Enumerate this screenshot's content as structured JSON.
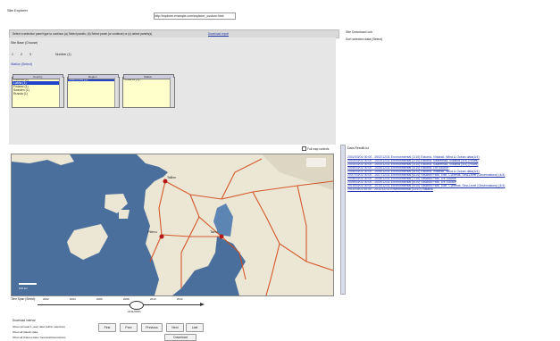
{
  "window": {
    "title": "Site Explorer",
    "url_label": "http://explorer.example.com/explorer_custom.html"
  },
  "header_bar": {
    "text": "Select a selection panel type to continue (a) Select panels; (b) Select panel (or continue) or (c) select panels(s)",
    "link": "Download report"
  },
  "search_panel": {
    "title": "Site Base (Choose)",
    "steps": [
      "1",
      "2",
      "3"
    ],
    "step_label": "Number (1)",
    "section_label": "Station (Select)",
    "lists": [
      {
        "header": "Country",
        "items": [
          "Estonia (1)",
          "Latvia (1)",
          "Finland (1)",
          "Sweden (1)",
          "Russia (1)"
        ],
        "selected": 1
      },
      {
        "header": "Region",
        "items": [
          "Saaremaa (1)"
        ],
        "selected": 0
      },
      {
        "header": "Station",
        "items": [
          "Vilsandi (1)"
        ],
        "selected": -1
      }
    ]
  },
  "right_top": {
    "title": "Site Download Link",
    "subtitle": "Sort selected data (Select)"
  },
  "map": {
    "toggle_label": "Full map controls",
    "city_labels": [
      "Tallinn",
      "Pärnu",
      "Tartu"
    ],
    "scale_label": "100 km"
  },
  "results": {
    "title": "Data ResultList",
    "rows": [
      "2002/03/01 00:00 - 2002/12/31 Environmental (1/10) Estonia, Vilsandi, Wind & Ocean data(4/4)",
      "2003/03/01 00:00 - 2003/12/31 Environmental (2/10) Estonia, Saaremaa, Vilsandi (4/4) (Rows)",
      "2004/03/01 00:00 - 2004/12/31 Environmental (3/10) Estonia, Saaremaa, Vilsandi (4/4) (Rows)",
      "2005/03/01 00:00 - 2005/12/31 Environmental (4/10) Estonia, 1hr Source",
      "2006/03/01 00:00 - 2006/12/31 Environmental (5/10) Estonia, Vilsandi, Wind & Ocean data(4/4)",
      "2007/03/01 00:00 - 2007/12/31 Environmental (6/10) Vilsandi Park, Tide, Currents, Sea-Level (Observations) (4/4)",
      "2008/03/01 00:00 - 2008/12/31 Environmental (7/10) Vilsandi Park, 1hr Source",
      "2009/03/01 00:00 - 2009/12/31 Environmental (8/10) Vilsandi Park, 1hr Source",
      "2010/03/01 00:00 - 2010/12/31 Environmental (9/10) Vilsandi Park, Tide, Currents, Sea-Level (Observations) (4/4)",
      "2011/03/01 00:00 - 2011/12/31 Environmental (10/10) Vilsandi"
    ]
  },
  "timeline": {
    "label": "Time Span (Select):",
    "ticks": [
      "2002",
      "2004",
      "2006",
      "2008",
      "2010",
      "2012"
    ],
    "current_label": "2011/09/01"
  },
  "bottom": {
    "option_title": "Download Interval",
    "option_1": "Show (at least 1 year) data (within selection)",
    "option_2": "Show all (latest) data",
    "option_3": "Show all (future) data / forecast/observations",
    "buttons": [
      "First",
      "Prev",
      "Previous",
      "Next",
      "Last"
    ],
    "download_button": "Download"
  },
  "colors": {
    "accent": "#2233aa",
    "panel": "#e6e6e6",
    "sea": "#4a6f9c",
    "land": "#ece6d4",
    "road": "#d24a1a"
  }
}
